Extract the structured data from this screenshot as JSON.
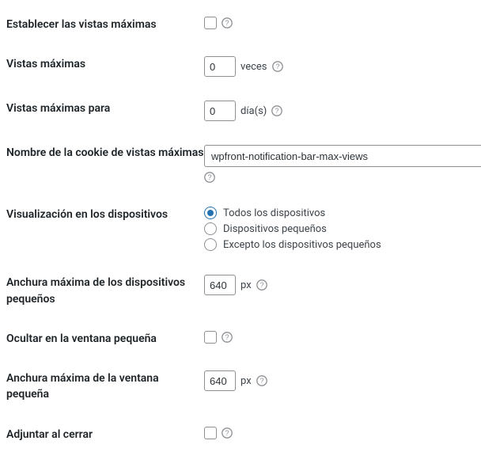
{
  "rows": {
    "set_max_views": {
      "label": "Establecer las vistas máximas"
    },
    "max_views": {
      "label": "Vistas máximas",
      "value": "0",
      "suffix": "veces"
    },
    "max_views_for": {
      "label": "Vistas máximas para",
      "value": "0",
      "suffix": "día(s)"
    },
    "cookie_name": {
      "label": "Nombre de la cookie de vistas máximas",
      "value": "wpfront-notification-bar-max-views"
    },
    "display": {
      "label": "Visualización en los dispositivos",
      "options": [
        {
          "label": "Todos los dispositivos",
          "checked": true
        },
        {
          "label": "Dispositivos pequeños",
          "checked": false
        },
        {
          "label": "Excepto los dispositivos pequeños",
          "checked": false
        }
      ]
    },
    "small_device_width": {
      "label": "Anchura máxima de los dispositivos pequeños",
      "value": "640",
      "suffix": "px"
    },
    "hide_small_window": {
      "label": "Ocultar en la ventana pequeña"
    },
    "small_window_width": {
      "label": "Anchura máxima de la ventana pequeña",
      "value": "640",
      "suffix": "px"
    },
    "attach_on_close": {
      "label": "Adjuntar al cerrar"
    }
  },
  "icons": {
    "help": "help-icon"
  }
}
